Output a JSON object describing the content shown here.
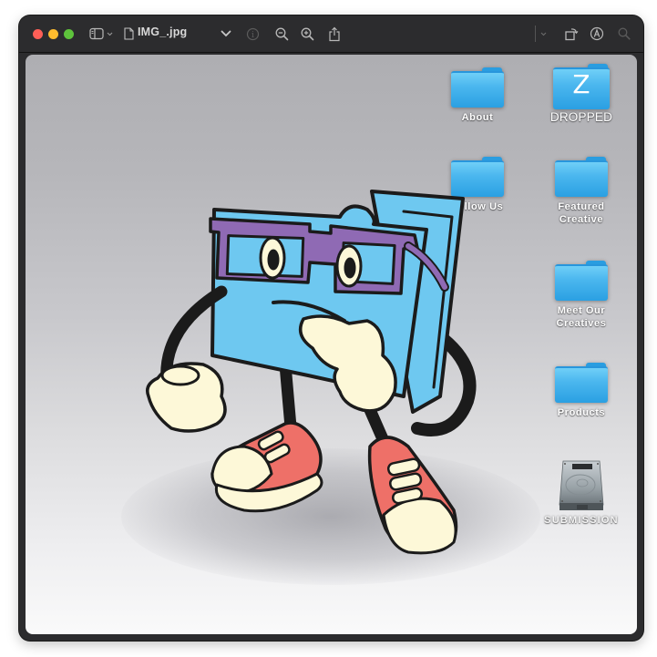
{
  "window": {
    "app": "Preview",
    "title": "IMG_.jpg"
  },
  "toolbar": {
    "traffic_lights": [
      {
        "name": "close",
        "color": "#fe5f57"
      },
      {
        "name": "minimize",
        "color": "#febc2e"
      },
      {
        "name": "zoom",
        "color": "#5ec33c"
      }
    ],
    "left_icons": [
      "sidebar-toggle-icon",
      "chevron-down-icon",
      "document-icon"
    ],
    "right_icons": [
      "title-chevron-icon",
      "info-icon",
      "zoom-out-icon",
      "zoom-in-icon",
      "share-icon",
      "markup-chevron-icon",
      "rotate-icon",
      "markup-pen-icon",
      "search-icon"
    ]
  },
  "image": {
    "description": "Cartoon blue folder mascot wearing purple glasses and red sneakers, thinking pose",
    "colors": {
      "folder": "#6ec8f0",
      "glasses": "#8f6ab4",
      "sneaker": "#ee7068",
      "cream": "#fdf8d8",
      "outline": "#1b1b1b"
    },
    "desktop_items": [
      {
        "label": "About",
        "type": "folder",
        "glyph": ""
      },
      {
        "label": "DROPPED",
        "type": "folder",
        "glyph": "Z"
      },
      {
        "label": "llow Us",
        "type": "folder",
        "glyph": ""
      },
      {
        "label": "Featured Creative",
        "label_lines": [
          "Featured",
          "Creative"
        ],
        "type": "folder",
        "glyph": ""
      },
      {
        "label": "Meet Our Creatives",
        "label_lines": [
          "Meet Our",
          "Creatives"
        ],
        "type": "folder",
        "glyph": ""
      },
      {
        "label": "Products",
        "type": "folder",
        "glyph": ""
      },
      {
        "label": "SUBMISSION",
        "type": "hard-drive",
        "glyph": ""
      }
    ]
  }
}
